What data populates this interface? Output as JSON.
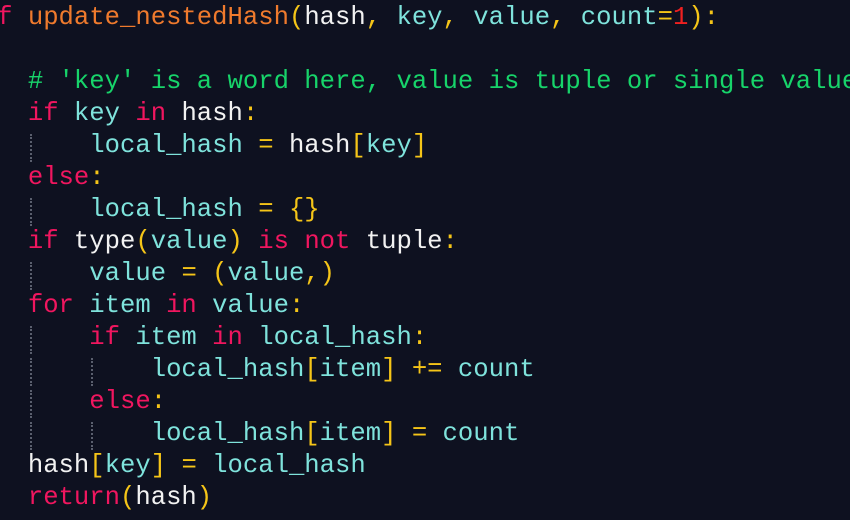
{
  "editor": {
    "language": "python",
    "colors": {
      "background": "#0e1120",
      "keyword": "#f0165f",
      "function_name": "#ef7a2d",
      "identifier": "#7fe3dc",
      "plain": "#f2f2f2",
      "operator": "#f5c518",
      "number": "#ef2020",
      "comment": "#17d46a"
    },
    "lines": [
      [
        {
          "t": "kw",
          "v": "def"
        },
        {
          "t": "pl",
          "v": " "
        },
        {
          "t": "fn",
          "v": "update_nestedHash"
        },
        {
          "t": "br",
          "v": "("
        },
        {
          "t": "pl",
          "v": "hash"
        },
        {
          "t": "op",
          "v": ","
        },
        {
          "t": "pl",
          "v": " "
        },
        {
          "t": "id",
          "v": "key"
        },
        {
          "t": "op",
          "v": ","
        },
        {
          "t": "pl",
          "v": " "
        },
        {
          "t": "id",
          "v": "value"
        },
        {
          "t": "op",
          "v": ","
        },
        {
          "t": "pl",
          "v": " "
        },
        {
          "t": "id",
          "v": "count"
        },
        {
          "t": "op",
          "v": "="
        },
        {
          "t": "num",
          "v": "1"
        },
        {
          "t": "br",
          "v": ")"
        },
        {
          "t": "op",
          "v": ":"
        }
      ],
      [],
      [
        {
          "t": "pl",
          "v": "    "
        },
        {
          "t": "cm",
          "v": "# 'key' is a word here, value is tuple or single value"
        }
      ],
      [
        {
          "t": "pl",
          "v": "    "
        },
        {
          "t": "kw",
          "v": "if"
        },
        {
          "t": "pl",
          "v": " "
        },
        {
          "t": "id",
          "v": "key"
        },
        {
          "t": "pl",
          "v": " "
        },
        {
          "t": "kw",
          "v": "in"
        },
        {
          "t": "pl",
          "v": " "
        },
        {
          "t": "pl",
          "v": "hash"
        },
        {
          "t": "op",
          "v": ":"
        }
      ],
      [
        {
          "t": "pl",
          "v": "        "
        },
        {
          "t": "id",
          "v": "local_hash"
        },
        {
          "t": "pl",
          "v": " "
        },
        {
          "t": "op",
          "v": "="
        },
        {
          "t": "pl",
          "v": " "
        },
        {
          "t": "pl",
          "v": "hash"
        },
        {
          "t": "br",
          "v": "["
        },
        {
          "t": "id",
          "v": "key"
        },
        {
          "t": "br",
          "v": "]"
        }
      ],
      [
        {
          "t": "pl",
          "v": "    "
        },
        {
          "t": "kw",
          "v": "else"
        },
        {
          "t": "op",
          "v": ":"
        }
      ],
      [
        {
          "t": "pl",
          "v": "        "
        },
        {
          "t": "id",
          "v": "local_hash"
        },
        {
          "t": "pl",
          "v": " "
        },
        {
          "t": "op",
          "v": "="
        },
        {
          "t": "pl",
          "v": " "
        },
        {
          "t": "br",
          "v": "{}"
        }
      ],
      [
        {
          "t": "pl",
          "v": "    "
        },
        {
          "t": "kw",
          "v": "if"
        },
        {
          "t": "pl",
          "v": " "
        },
        {
          "t": "pl",
          "v": "type"
        },
        {
          "t": "br",
          "v": "("
        },
        {
          "t": "id",
          "v": "value"
        },
        {
          "t": "br",
          "v": ")"
        },
        {
          "t": "pl",
          "v": " "
        },
        {
          "t": "kw",
          "v": "is"
        },
        {
          "t": "pl",
          "v": " "
        },
        {
          "t": "kw",
          "v": "not"
        },
        {
          "t": "pl",
          "v": " "
        },
        {
          "t": "pl",
          "v": "tuple"
        },
        {
          "t": "op",
          "v": ":"
        }
      ],
      [
        {
          "t": "pl",
          "v": "        "
        },
        {
          "t": "id",
          "v": "value"
        },
        {
          "t": "pl",
          "v": " "
        },
        {
          "t": "op",
          "v": "="
        },
        {
          "t": "pl",
          "v": " "
        },
        {
          "t": "br",
          "v": "("
        },
        {
          "t": "id",
          "v": "value"
        },
        {
          "t": "op",
          "v": ","
        },
        {
          "t": "br",
          "v": ")"
        }
      ],
      [
        {
          "t": "pl",
          "v": "    "
        },
        {
          "t": "kw",
          "v": "for"
        },
        {
          "t": "pl",
          "v": " "
        },
        {
          "t": "id",
          "v": "item"
        },
        {
          "t": "pl",
          "v": " "
        },
        {
          "t": "kw",
          "v": "in"
        },
        {
          "t": "pl",
          "v": " "
        },
        {
          "t": "id",
          "v": "value"
        },
        {
          "t": "op",
          "v": ":"
        }
      ],
      [
        {
          "t": "pl",
          "v": "        "
        },
        {
          "t": "kw",
          "v": "if"
        },
        {
          "t": "pl",
          "v": " "
        },
        {
          "t": "id",
          "v": "item"
        },
        {
          "t": "pl",
          "v": " "
        },
        {
          "t": "kw",
          "v": "in"
        },
        {
          "t": "pl",
          "v": " "
        },
        {
          "t": "id",
          "v": "local_hash"
        },
        {
          "t": "op",
          "v": ":"
        }
      ],
      [
        {
          "t": "pl",
          "v": "            "
        },
        {
          "t": "id",
          "v": "local_hash"
        },
        {
          "t": "br",
          "v": "["
        },
        {
          "t": "id",
          "v": "item"
        },
        {
          "t": "br",
          "v": "]"
        },
        {
          "t": "pl",
          "v": " "
        },
        {
          "t": "op",
          "v": "+="
        },
        {
          "t": "pl",
          "v": " "
        },
        {
          "t": "id",
          "v": "count"
        }
      ],
      [
        {
          "t": "pl",
          "v": "        "
        },
        {
          "t": "kw",
          "v": "else"
        },
        {
          "t": "op",
          "v": ":"
        }
      ],
      [
        {
          "t": "pl",
          "v": "            "
        },
        {
          "t": "id",
          "v": "local_hash"
        },
        {
          "t": "br",
          "v": "["
        },
        {
          "t": "id",
          "v": "item"
        },
        {
          "t": "br",
          "v": "]"
        },
        {
          "t": "pl",
          "v": " "
        },
        {
          "t": "op",
          "v": "="
        },
        {
          "t": "pl",
          "v": " "
        },
        {
          "t": "id",
          "v": "count"
        }
      ],
      [
        {
          "t": "pl",
          "v": "    "
        },
        {
          "t": "pl",
          "v": "hash"
        },
        {
          "t": "br",
          "v": "["
        },
        {
          "t": "id",
          "v": "key"
        },
        {
          "t": "br",
          "v": "]"
        },
        {
          "t": "pl",
          "v": " "
        },
        {
          "t": "op",
          "v": "="
        },
        {
          "t": "pl",
          "v": " "
        },
        {
          "t": "id",
          "v": "local_hash"
        }
      ],
      [
        {
          "t": "pl",
          "v": "    "
        },
        {
          "t": "kw",
          "v": "return"
        },
        {
          "t": "br",
          "v": "("
        },
        {
          "t": "pl",
          "v": "hash"
        },
        {
          "t": "br",
          "v": ")"
        }
      ]
    ]
  }
}
